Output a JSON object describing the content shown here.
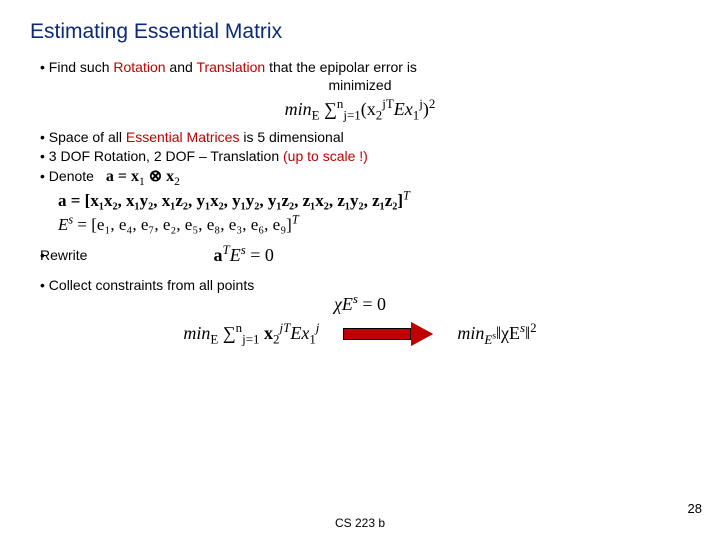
{
  "title": "Estimating Essential Matrix",
  "bullets": {
    "b1a": "Find such ",
    "b1rot": "Rotation",
    "b1and": " and ",
    "b1tr": "Translation",
    "b1rest": " that the epipolar error is",
    "b1sub": "minimized",
    "b2a": "Space of all ",
    "b2em": "Essential Matrices",
    "b2b": " is 5 dimensional",
    "b3a": "3 DOF Rotation, 2 DOF – Translation ",
    "b3s": "(up to scale !)",
    "b4": "Denote",
    "b5": "Rewrite",
    "b6": "Collect constraints from all points"
  },
  "formulas": {
    "f1_a": "min",
    "f1_b": "E",
    "f1_c": " ∑",
    "f1_d": "j=1",
    "f1_e": "n",
    "f1_f": "(x",
    "f1_g": "2",
    "f1_h": "jT",
    "f1_i": "Ex",
    "f1_j": "1",
    "f1_k": "j",
    "f1_l": ")",
    "f1_m": "2",
    "denote_a": "a = x",
    "denote_b": "1",
    "denote_c": " ⊗ x",
    "denote_d": "2",
    "avec": "a = [x₁x₂, x₁y₂, x₁z₂, y₁x₂, y₁y₂, y₁z₂, z₁x₂, z₁y₂, z₁z₂]",
    "avec_t": "T",
    "esvec": "E",
    "esvec_s": "s",
    "esvec_eq": " = [e₁, e₄, e₇, e₂, e₅, e₈, e₃, e₆, e₉]",
    "esvec_t": "T",
    "rewrite_a": "a",
    "rewrite_b": "T",
    "rewrite_c": "E",
    "rewrite_d": "s",
    "rewrite_e": " = 0",
    "chi": "χE",
    "chi_s": "s",
    "chi_eq": " = 0",
    "left_a": "min",
    "left_b": "E",
    "left_c": " ∑",
    "left_d": "j=1",
    "left_e": "n",
    "left_f": " x",
    "left_g": "2",
    "left_h": "jT",
    "left_i": "Ex",
    "left_j": "1",
    "left_k": "j",
    "right_a": "min",
    "right_b": "E",
    "right_bs": "s",
    "right_c": "‖χE",
    "right_d": "s",
    "right_e": "‖",
    "right_f": "2"
  },
  "footer": "CS 223 b",
  "page": "28"
}
